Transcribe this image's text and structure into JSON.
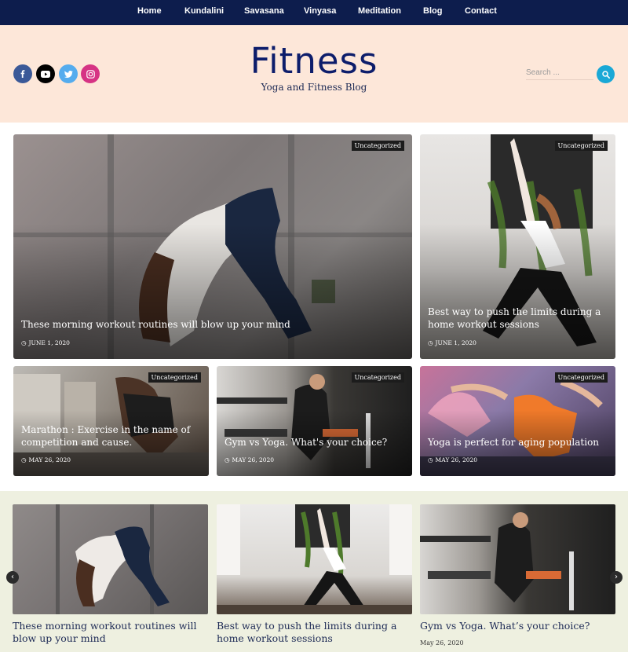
{
  "nav": {
    "items": [
      {
        "label": "Home"
      },
      {
        "label": "Kundalini"
      },
      {
        "label": "Savasana"
      },
      {
        "label": "Vinyasa"
      },
      {
        "label": "Meditation"
      },
      {
        "label": "Blog"
      },
      {
        "label": "Contact"
      }
    ]
  },
  "header": {
    "site_title": "Fitness",
    "tagline": "Yoga and Fitness Blog",
    "social": [
      "facebook-icon",
      "youtube-icon",
      "twitter-icon",
      "instagram-icon"
    ],
    "search_placeholder": "Search ..."
  },
  "posts": [
    {
      "category": "Uncategorized",
      "title": "These morning workout routines will blow up your mind",
      "date": "JUNE 1, 2020"
    },
    {
      "category": "Uncategorized",
      "title": "Best way to push the limits during a home workout sessions",
      "date": "JUNE 1, 2020"
    },
    {
      "category": "Uncategorized",
      "title": "Marathon : Exercise in the name of competition and cause.",
      "date": "MAY 26, 2020"
    },
    {
      "category": "Uncategorized",
      "title": "Gym vs Yoga. What's your choice?",
      "date": "MAY 26, 2020"
    },
    {
      "category": "Uncategorized",
      "title": "Yoga is perfect for aging population",
      "date": "MAY 26, 2020"
    }
  ],
  "featured": [
    {
      "title": "These morning workout routines will blow up your mind"
    },
    {
      "title": "Best way to push the limits during a home workout sessions"
    },
    {
      "title": "Gym vs Yoga. What’s your choice?",
      "date": "May 26, 2020"
    }
  ],
  "colors": {
    "nav_bg": "#0d1d4d",
    "header_bg": "#fde7d9",
    "accent": "#1aa8d6",
    "strip_bg": "#eef0e0",
    "title": "#0d1d6b"
  }
}
